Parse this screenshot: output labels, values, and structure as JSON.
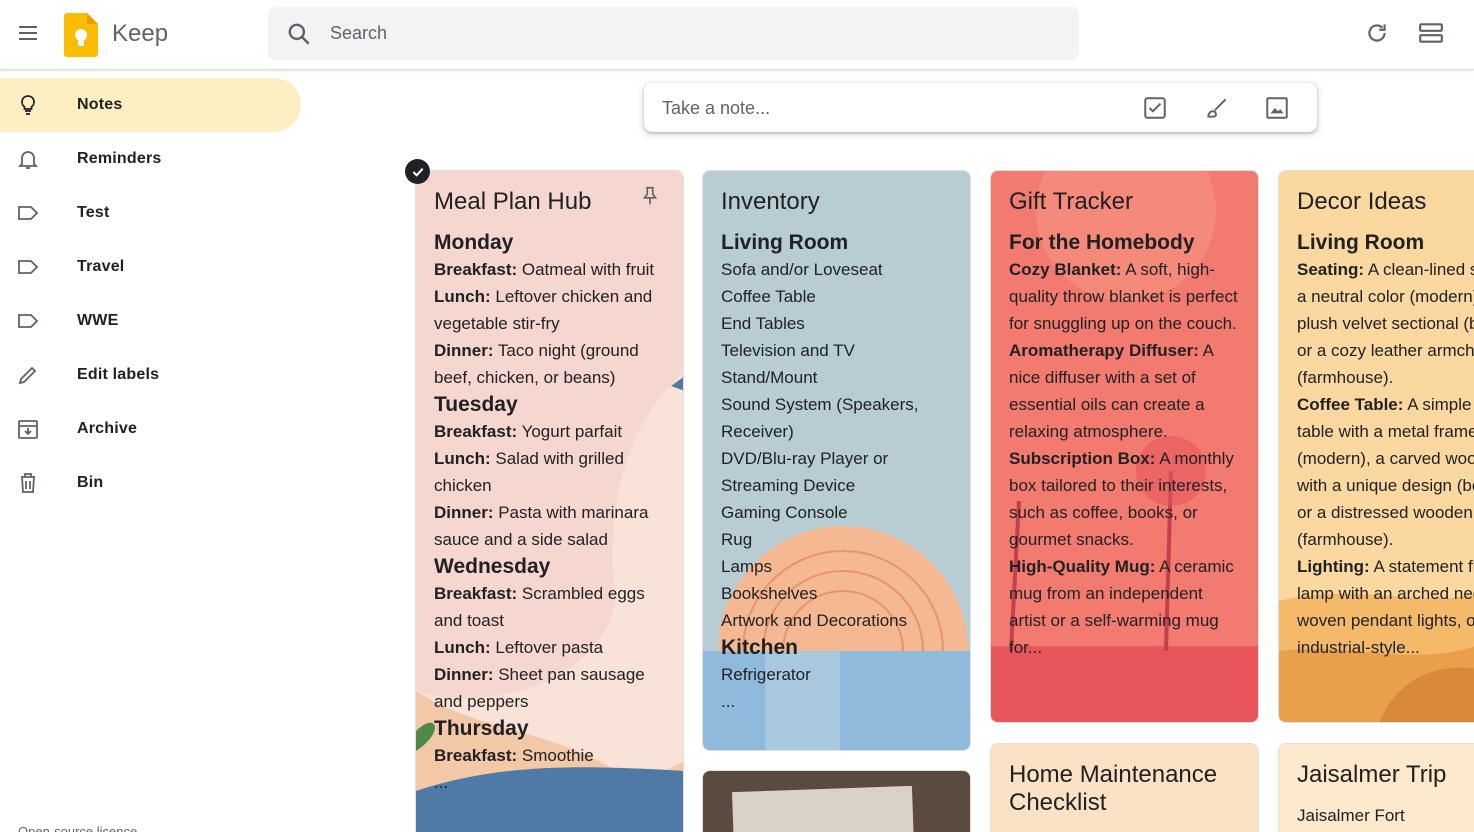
{
  "app": {
    "name": "Keep"
  },
  "search": {
    "placeholder": "Search"
  },
  "sidebar": {
    "items": [
      {
        "label": "Notes",
        "icon": "lightbulb-icon",
        "active": true
      },
      {
        "label": "Reminders",
        "icon": "bell-icon"
      },
      {
        "label": "Test",
        "icon": "label-icon"
      },
      {
        "label": "Travel",
        "icon": "label-icon"
      },
      {
        "label": "WWE",
        "icon": "label-icon"
      },
      {
        "label": "Edit labels",
        "icon": "pencil-icon"
      },
      {
        "label": "Archive",
        "icon": "archive-icon"
      },
      {
        "label": "Bin",
        "icon": "trash-icon"
      }
    ],
    "license": "Open-source licence"
  },
  "take_note": {
    "placeholder": "Take a note..."
  },
  "notes": {
    "meal": {
      "title": "Meal Plan Hub",
      "color": "#f6d7d0",
      "lines": [
        {
          "h": "Monday"
        },
        {
          "k": "Breakfast:",
          "v": " Oatmeal with fruit"
        },
        {
          "k": "Lunch:",
          "v": " Leftover chicken and"
        },
        {
          "v": "vegetable stir-fry"
        },
        {
          "k": "Dinner:",
          "v": " Taco night (ground"
        },
        {
          "v": "beef, chicken, or beans)"
        },
        {
          "h": "Tuesday"
        },
        {
          "k": "Breakfast:",
          "v": " Yogurt parfait"
        },
        {
          "k": "Lunch:",
          "v": " Salad with grilled"
        },
        {
          "v": "chicken"
        },
        {
          "k": "Dinner:",
          "v": " Pasta with marinara"
        },
        {
          "v": "sauce and a side salad"
        },
        {
          "h": "Wednesday"
        },
        {
          "k": "Breakfast:",
          "v": " Scrambled eggs"
        },
        {
          "v": "and toast"
        },
        {
          "k": "Lunch:",
          "v": " Leftover pasta"
        },
        {
          "k": "Dinner:",
          "v": " Sheet pan sausage"
        },
        {
          "v": "and peppers"
        },
        {
          "h": "Thursday"
        },
        {
          "k": "Breakfast:",
          "v": " Smoothie"
        },
        {
          "v": "..."
        }
      ]
    },
    "inventory": {
      "title": "Inventory",
      "color": "#b8ccd4",
      "lines": [
        {
          "h": "Living Room"
        },
        {
          "v": "Sofa and/or Loveseat"
        },
        {
          "v": "Coffee Table"
        },
        {
          "v": "End Tables"
        },
        {
          "v": "Television and TV Stand/Mount"
        },
        {
          "v": "Sound System (Speakers,"
        },
        {
          "v": "Receiver)"
        },
        {
          "v": "DVD/Blu-ray Player or"
        },
        {
          "v": "Streaming Device"
        },
        {
          "v": "Gaming Console"
        },
        {
          "v": "Rug"
        },
        {
          "v": "Lamps"
        },
        {
          "v": "Bookshelves"
        },
        {
          "v": "Artwork and Decorations"
        },
        {
          "h": "Kitchen"
        },
        {
          "v": "Refrigerator"
        },
        {
          "v": "..."
        }
      ]
    },
    "gift": {
      "title": "Gift Tracker",
      "color": "#f28b82",
      "lines": [
        {
          "h": "For the Homebody"
        },
        {
          "k": "Cozy Blanket:",
          "v": " A soft, high-"
        },
        {
          "v": "quality throw blanket is perfect"
        },
        {
          "v": "for snuggling up on the couch."
        },
        {
          "k": "Aromatherapy Diffuser:",
          "v": " A"
        },
        {
          "v": "nice diffuser with a set of"
        },
        {
          "v": "essential oils can create a"
        },
        {
          "v": "relaxing atmosphere."
        },
        {
          "k": "Subscription Box:",
          "v": " A monthly"
        },
        {
          "v": "box tailored to their interests,"
        },
        {
          "v": "such as coffee, books, or"
        },
        {
          "v": "gourmet snacks."
        },
        {
          "k": "High-Quality Mug:",
          "v": " A ceramic"
        },
        {
          "v": "mug from an independent"
        },
        {
          "v": "artist or a self-warming mug"
        },
        {
          "v": "for..."
        }
      ]
    },
    "decor": {
      "title": "Decor Ideas",
      "color": "#fbd38d",
      "lines": [
        {
          "h": "Living Room"
        },
        {
          "k": "Seating:",
          "v": " A clean-lined s"
        },
        {
          "v": "a neutral color (modern)"
        },
        {
          "v": "plush velvet sectional (b"
        },
        {
          "v": "or a cozy leather armcha"
        },
        {
          "v": "(farmhouse)."
        },
        {
          "k": "Coffee Table:",
          "v": " A simple"
        },
        {
          "v": "table with a metal frame"
        },
        {
          "v": "(modern), a carved woo"
        },
        {
          "v": "with a unique design (bo"
        },
        {
          "v": "or a distressed wooden"
        },
        {
          "v": "(farmhouse)."
        },
        {
          "k": "Lighting:",
          "v": " A statement fl"
        },
        {
          "v": "lamp with an arched nec"
        },
        {
          "v": "woven pendant lights, o"
        },
        {
          "v": "industrial-style..."
        }
      ]
    },
    "home": {
      "title": "Home Maintenance Checklist",
      "color": "#fce2c4"
    },
    "jaisalmer": {
      "title": "Jaisalmer Trip",
      "color": "#fde9cc",
      "first_line": "Jaisalmer Fort"
    },
    "photo": {
      "caption": ""
    }
  }
}
